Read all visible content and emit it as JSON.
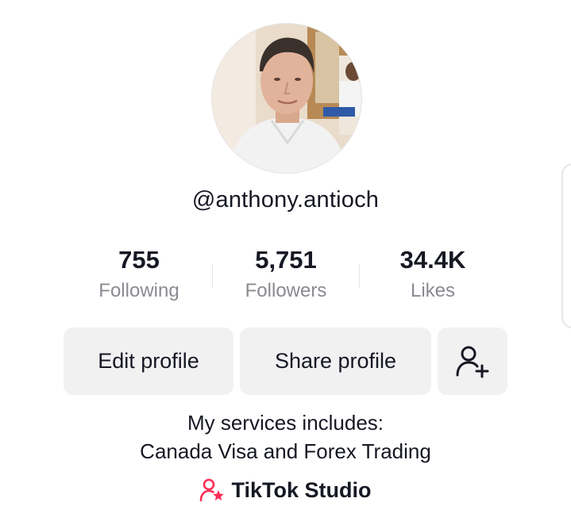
{
  "profile": {
    "username": "@anthony.antioch",
    "avatar_icon": "profile-photo"
  },
  "stats": [
    {
      "value": "755",
      "label": "Following"
    },
    {
      "value": "5,751",
      "label": "Followers"
    },
    {
      "value": "34.4K",
      "label": "Likes"
    }
  ],
  "actions": {
    "edit_label": "Edit profile",
    "share_label": "Share profile",
    "add_friend_icon": "add-friend-icon"
  },
  "bio": {
    "line1": "My services includes:",
    "line2": "Canada Visa and Forex Trading"
  },
  "studio": {
    "label": "TikTok Studio",
    "icon_color": "#fe2c55"
  },
  "colors": {
    "text": "#161823",
    "muted": "#8a8b91",
    "button_bg": "#f1f1f2",
    "accent": "#fe2c55"
  }
}
